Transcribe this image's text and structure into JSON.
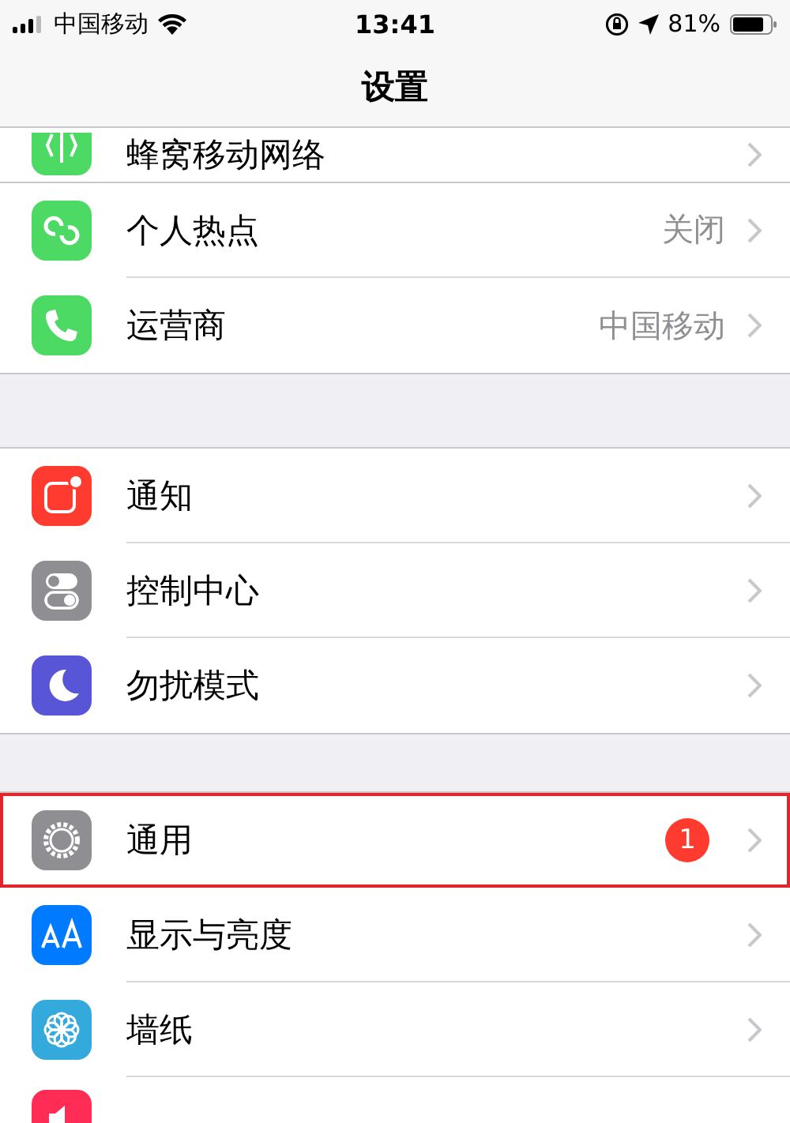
{
  "status_bar": {
    "carrier": "中国移动",
    "time": "13:41",
    "battery": "81%"
  },
  "nav_bar": {
    "title": "设置"
  },
  "groups": [
    {
      "items": [
        {
          "label": "蜂窝移动网络",
          "kind": "antenna",
          "color": "#4cd964"
        }
      ]
    },
    {
      "items": [
        {
          "label": "个人热点",
          "kind": "hotspot",
          "color": "#4cd964",
          "detail": "关闭"
        },
        {
          "label": "运营商",
          "kind": "phone",
          "color": "#4cd964",
          "detail": "中国移动"
        }
      ]
    },
    {
      "items": [
        {
          "label": "通知",
          "kind": "notify",
          "color": "#ff3b30"
        },
        {
          "label": "控制中心",
          "kind": "toggles",
          "color": "#8e8e93"
        },
        {
          "label": "勿扰模式",
          "kind": "moon",
          "color": "#5856d6"
        }
      ]
    },
    {
      "items": [
        {
          "label": "通用",
          "kind": "gear",
          "color": "#8e8e93",
          "badge": "1",
          "highlighted": true
        },
        {
          "label": "显示与亮度",
          "kind": "aa",
          "color": "#007aff"
        },
        {
          "label": "墙纸",
          "kind": "flower",
          "color": "#34aadc"
        },
        {
          "kind": "speaker",
          "color": "#ff2d55"
        }
      ]
    }
  ]
}
